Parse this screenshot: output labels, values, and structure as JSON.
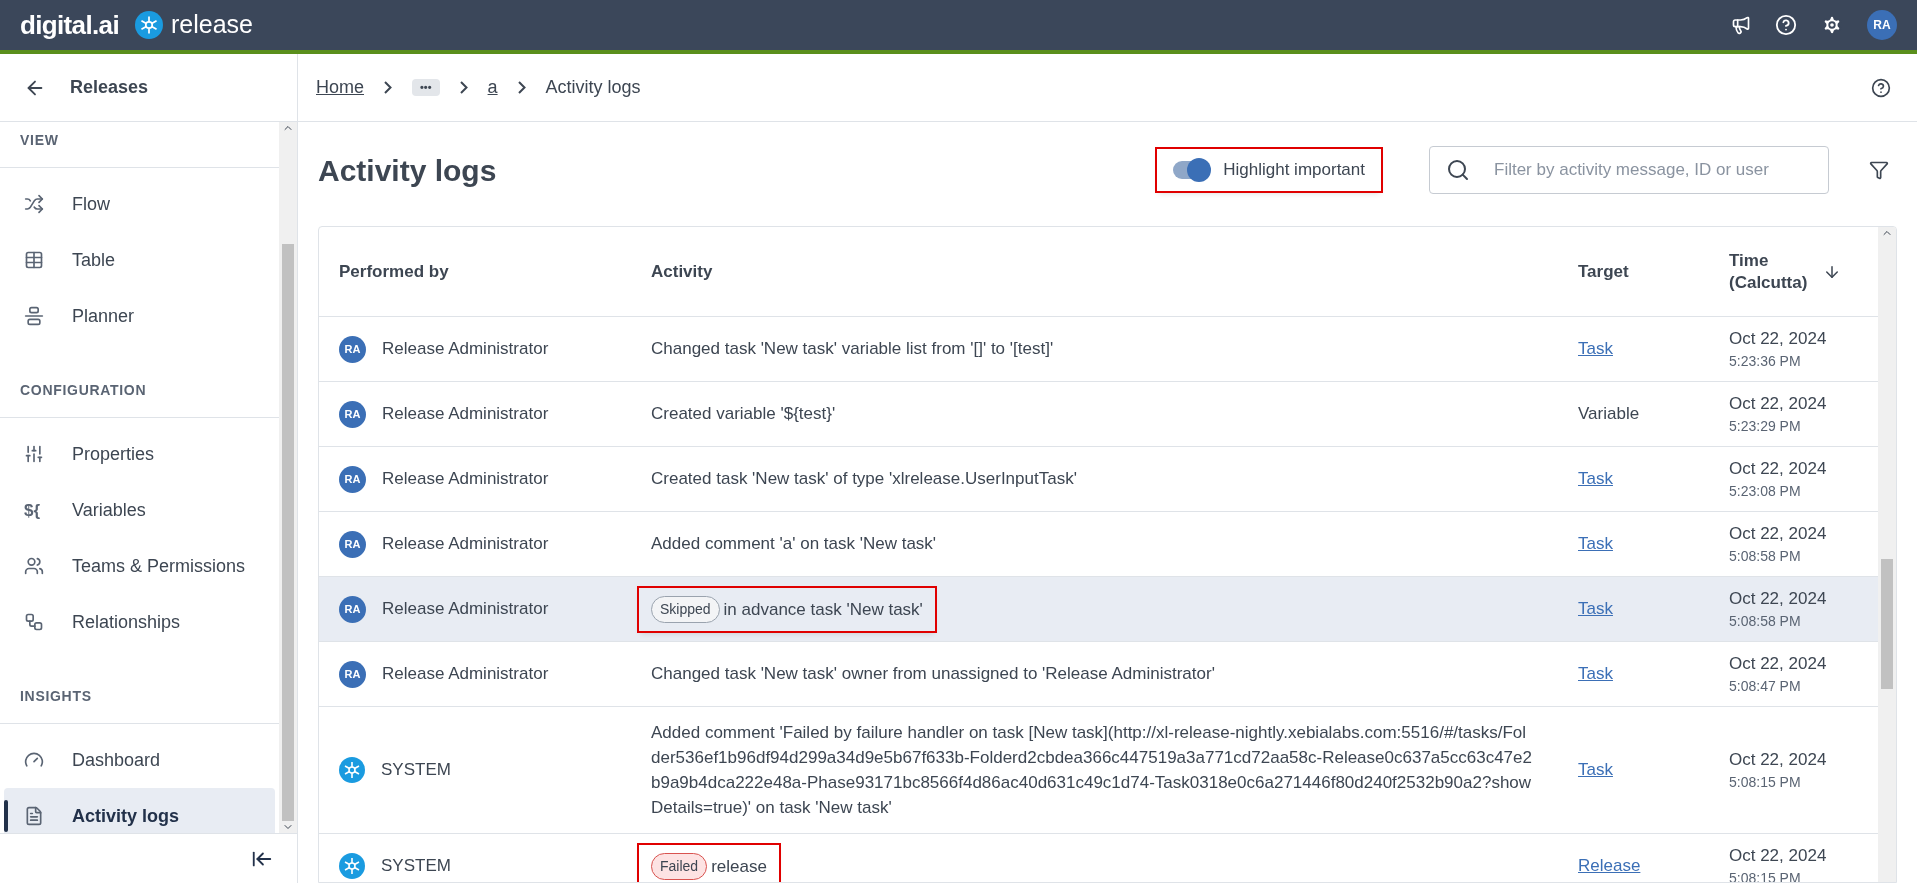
{
  "header": {
    "logo_text": "digital.ai",
    "product": "release",
    "avatar": "RA"
  },
  "sidebar": {
    "back_label": "Releases",
    "sections": [
      {
        "title": "VIEW",
        "items": [
          {
            "label": "Flow",
            "selected": false
          },
          {
            "label": "Table",
            "selected": false
          },
          {
            "label": "Planner",
            "selected": false
          }
        ]
      },
      {
        "title": "CONFIGURATION",
        "items": [
          {
            "label": "Properties",
            "selected": false
          },
          {
            "label": "Variables",
            "icon_text": "${",
            "selected": false
          },
          {
            "label": "Teams & Permissions",
            "selected": false
          },
          {
            "label": "Relationships",
            "selected": false
          }
        ]
      },
      {
        "title": "INSIGHTS",
        "items": [
          {
            "label": "Dashboard",
            "selected": false
          },
          {
            "label": "Activity logs",
            "selected": true
          }
        ]
      }
    ]
  },
  "breadcrumb": [
    {
      "label": "Home",
      "kind": "link"
    },
    {
      "label": "•••",
      "kind": "ellipsis"
    },
    {
      "label": "a",
      "kind": "link"
    },
    {
      "label": "Activity logs",
      "kind": "current"
    }
  ],
  "title": "Activity logs",
  "highlight_toggle": {
    "label": "Highlight important",
    "on": true,
    "annotated": true
  },
  "search": {
    "placeholder": "Filter by activity message, ID or user"
  },
  "table": {
    "columns": [
      "Performed by",
      "Activity",
      "Target",
      "Time\n(Calcutta)"
    ],
    "rows": [
      {
        "kind": "user",
        "initials": "RA",
        "user": "Release Administrator",
        "activity": "Changed task 'New task' variable list from '[]' to '[test]'",
        "target": {
          "text": "Task",
          "kind": "link"
        },
        "date": "Oct 22, 2024",
        "time": "5:23:36 PM",
        "highlighted": false,
        "annotated": false
      },
      {
        "kind": "user",
        "initials": "RA",
        "user": "Release Administrator",
        "activity": "Created variable '${test}'",
        "target": {
          "text": "Variable",
          "kind": "text"
        },
        "date": "Oct 22, 2024",
        "time": "5:23:29 PM",
        "highlighted": false,
        "annotated": false
      },
      {
        "kind": "user",
        "initials": "RA",
        "user": "Release Administrator",
        "activity": "Created task 'New task' of type 'xlrelease.UserInputTask'",
        "target": {
          "text": "Task",
          "kind": "link"
        },
        "date": "Oct 22, 2024",
        "time": "5:23:08 PM",
        "highlighted": false,
        "annotated": false
      },
      {
        "kind": "user",
        "initials": "RA",
        "user": "Release Administrator",
        "activity": "Added comment 'a' on task 'New task'",
        "target": {
          "text": "Task",
          "kind": "link"
        },
        "date": "Oct 22, 2024",
        "time": "5:08:58 PM",
        "highlighted": false,
        "annotated": false
      },
      {
        "kind": "user",
        "initials": "RA",
        "user": "Release Administrator",
        "badge": {
          "text": "Skipped",
          "kind": "skipped"
        },
        "activity": "in advance task 'New task'",
        "target": {
          "text": "Task",
          "kind": "link"
        },
        "date": "Oct 22, 2024",
        "time": "5:08:58 PM",
        "highlighted": true,
        "annotated": true
      },
      {
        "kind": "user",
        "initials": "RA",
        "user": "Release Administrator",
        "activity": "Changed task 'New task' owner from unassigned to 'Release Administrator'",
        "target": {
          "text": "Task",
          "kind": "link"
        },
        "date": "Oct 22, 2024",
        "time": "5:08:47 PM",
        "highlighted": false,
        "annotated": false
      },
      {
        "kind": "system",
        "user": "SYSTEM",
        "activity": "Added comment 'Failed by failure handler on task [New task](http://xl-release-nightly.xebialabs.com:5516/#/tasks/Folder536ef1b96df94d299a34d9e5b67f633b-Folderd2cbdea366c447519a3a771cd72aa58c-Release0c637a5cc63c47e2b9a9b4dca222e48a-Phase93171bc8566f4d86ac40d631c49c1d74-Task0318e0c6a271446f80d240f2532b90a2?showDetails=true)' on task 'New task'",
        "target": {
          "text": "Task",
          "kind": "link"
        },
        "date": "Oct 22, 2024",
        "time": "5:08:15 PM",
        "highlighted": false,
        "annotated": false
      },
      {
        "kind": "system",
        "user": "SYSTEM",
        "badge": {
          "text": "Failed",
          "kind": "failed"
        },
        "activity": "release",
        "target": {
          "text": "Release",
          "kind": "link"
        },
        "date": "Oct 22, 2024",
        "time": "5:08:15 PM",
        "highlighted": false,
        "annotated": true
      }
    ]
  }
}
